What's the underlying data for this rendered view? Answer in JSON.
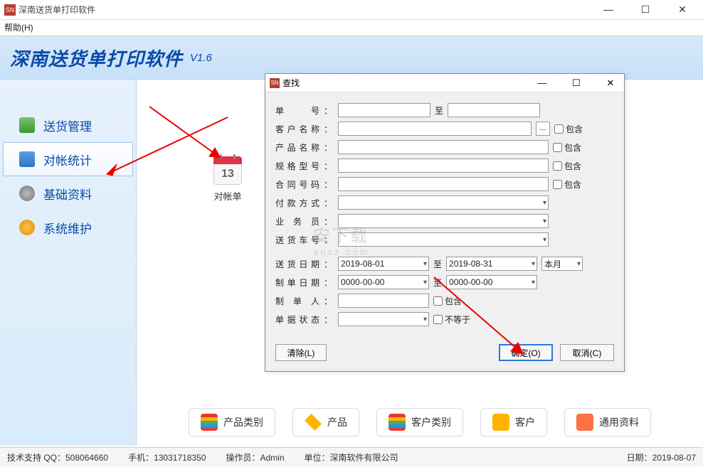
{
  "window": {
    "icon": "SN",
    "title": "深南送货单打印软件"
  },
  "menubar": {
    "help": "帮助(H)"
  },
  "header": {
    "appname": "深南送货单打印软件",
    "version": "V1.6"
  },
  "sidebar": {
    "items": [
      {
        "name": "delivery-mgmt",
        "label": "送货管理",
        "icon_color": "linear-gradient(#7ac26e,#3a9a2d)"
      },
      {
        "name": "reconcile-stats",
        "label": "对帐统计",
        "icon_color": "linear-gradient(#5aa0e6,#2e74c0)"
      },
      {
        "name": "basic-data",
        "label": "基础资料",
        "icon_color": "radial-gradient(#bbb,#777)"
      },
      {
        "name": "sys-maint",
        "label": "系统维护",
        "icon_color": "radial-gradient(#ffc24a,#e88b00)"
      }
    ],
    "active_index": 1
  },
  "content_icon": {
    "day": "13",
    "label": "对帐单"
  },
  "dialog": {
    "icon": "SN",
    "title": "查找",
    "labels": {
      "order_no": "单　　号",
      "to": "至",
      "customer": "客户名称",
      "product": "产品名称",
      "spec": "规格型号",
      "contract": "合同号码",
      "payment": "付款方式",
      "salesman": "业 务 员",
      "vehicle": "送货车号",
      "ship_date": "送货日期",
      "make_date": "制单日期",
      "maker": "制 单 人",
      "status": "单据状态",
      "include": "包含",
      "not_equal": "不等于",
      "this_month": "本月",
      "clear": "清除(L)",
      "ok": "确定(O)",
      "cancel": "取消(C)"
    },
    "values": {
      "ship_from": "2019-08-01",
      "ship_to": "2019-08-31",
      "make_from": "0000-00-00",
      "make_to": "0000-00-00"
    }
  },
  "quickbar": [
    {
      "label": "产品类别",
      "color": "#4caf50"
    },
    {
      "label": "产品",
      "color": "#ffb300"
    },
    {
      "label": "客户类别",
      "color": "#4caf50"
    },
    {
      "label": "客户",
      "color": "#ffb300"
    },
    {
      "label": "通用资料",
      "color": "#ff7043"
    }
  ],
  "statusbar": {
    "tech": "技术支持 QQ：508064660",
    "phone": "手机：13031718350",
    "operator": "操作员：Admin",
    "company": "单位：深南软件有限公司",
    "date": "日期：2019-08-07"
  },
  "watermark": {
    "main": "安下载",
    "sub": "anxz.com"
  }
}
